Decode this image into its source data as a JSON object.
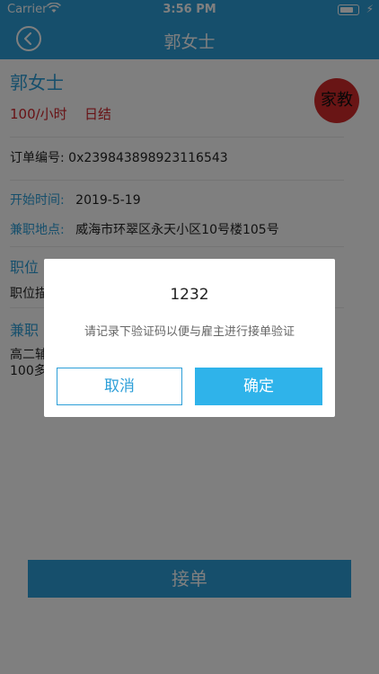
{
  "status_bar": {
    "carrier": "Carrier",
    "time": "3:56 PM"
  },
  "nav": {
    "title": "郭女士"
  },
  "job": {
    "name": "郭女士",
    "rate": "100/小时",
    "settlement": "日结",
    "category_badge": "家教",
    "order_number": "订单编号:  0x239843898923116543",
    "start_label": "开始时间:",
    "start_value": "2019-5-19",
    "location_label": "兼职地点:",
    "location_value": "威海市环翠区永天小区10号楼105号",
    "section1_title": "职位",
    "section1_body": "职位描",
    "section2_title": "兼职",
    "section2_line1": "高二辅",
    "section2_line2": "100多"
  },
  "bottom": {
    "accept_label": "接单"
  },
  "dialog": {
    "code": "1232",
    "message": "请记录下验证码以便与雇主进行接单验证",
    "cancel_label": "取消",
    "confirm_label": "确定"
  },
  "colors": {
    "primary": "#2d9fd8",
    "accent_red": "#d0252a",
    "confirm": "#2fb3ea"
  }
}
